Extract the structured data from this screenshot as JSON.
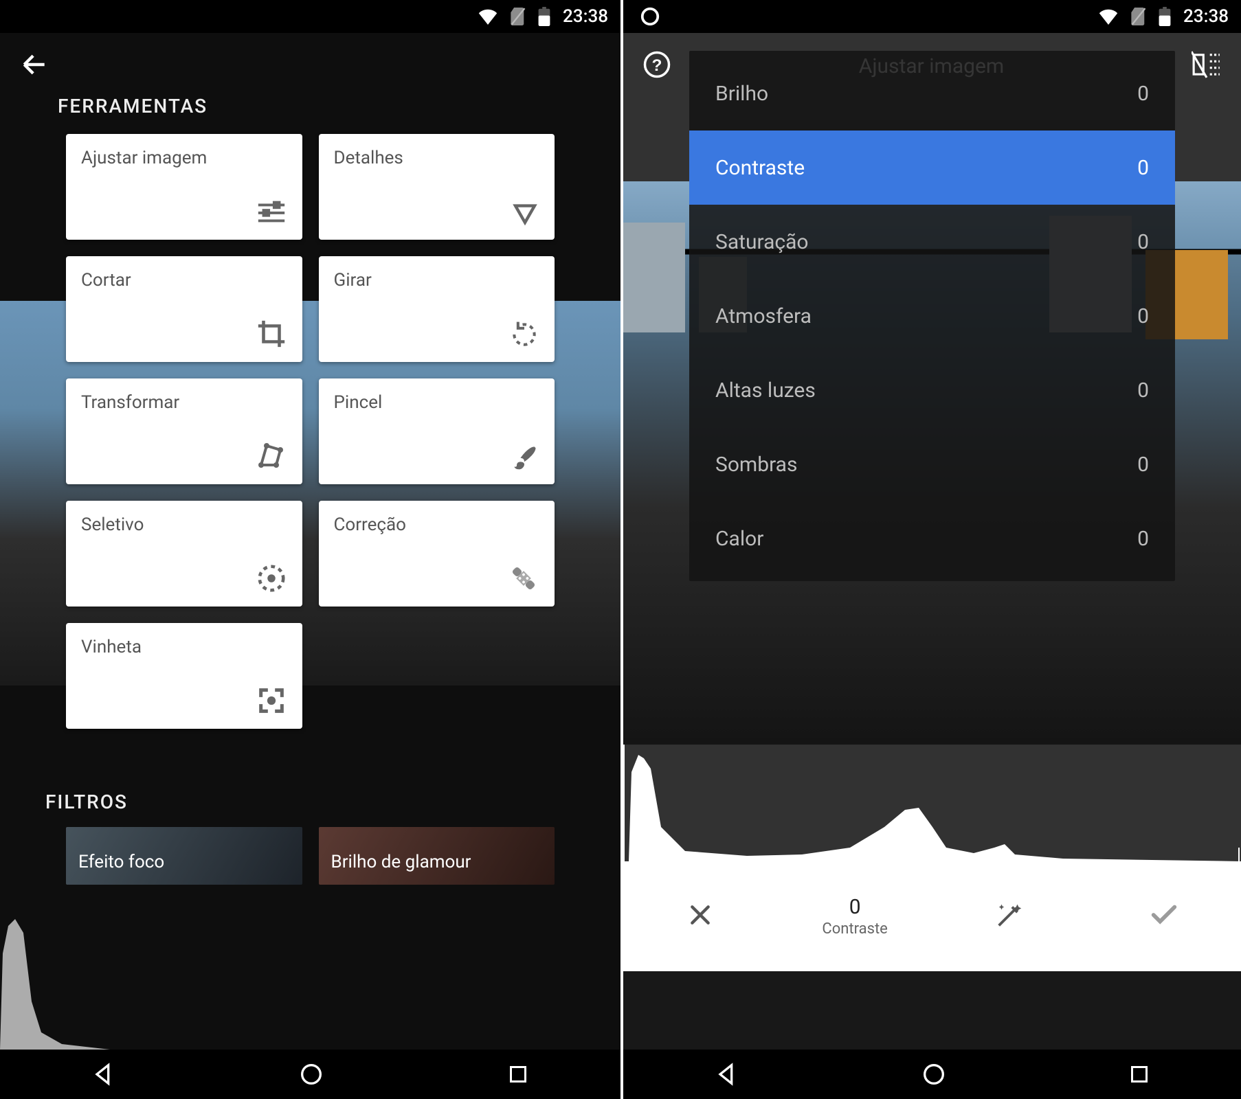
{
  "status": {
    "time": "23:38"
  },
  "left": {
    "sections": {
      "tools_title": "FERRAMENTAS",
      "filters_title": "FILTROS"
    },
    "tools": [
      {
        "label": "Ajustar imagem",
        "icon": "tune-icon"
      },
      {
        "label": "Detalhes",
        "icon": "triangle-down-icon"
      },
      {
        "label": "Cortar",
        "icon": "crop-icon"
      },
      {
        "label": "Girar",
        "icon": "rotate-icon"
      },
      {
        "label": "Transformar",
        "icon": "transform-icon"
      },
      {
        "label": "Pincel",
        "icon": "brush-icon"
      },
      {
        "label": "Seletivo",
        "icon": "selective-icon"
      },
      {
        "label": "Correção",
        "icon": "healing-icon"
      },
      {
        "label": "Vinheta",
        "icon": "vignette-icon"
      }
    ],
    "filters": [
      {
        "label": "Efeito foco"
      },
      {
        "label": "Brilho de glamour"
      }
    ]
  },
  "right": {
    "header": {
      "title": "Ajustar imagem"
    },
    "adjust": [
      {
        "label": "Brilho",
        "value": "0"
      },
      {
        "label": "Contraste",
        "value": "0",
        "selected": true
      },
      {
        "label": "Saturação",
        "value": "0"
      },
      {
        "label": "Atmosfera",
        "value": "0"
      },
      {
        "label": "Altas luzes",
        "value": "0"
      },
      {
        "label": "Sombras",
        "value": "0"
      },
      {
        "label": "Calor",
        "value": "0"
      }
    ],
    "bottom": {
      "value": "0",
      "label": "Contraste"
    }
  }
}
